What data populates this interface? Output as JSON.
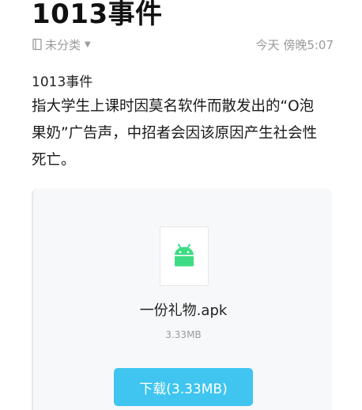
{
  "note": {
    "title": "1013事件",
    "category": "未分类",
    "timestamp": "今天 傍晚5:07",
    "subtitle": "1013事件",
    "body_lines": [
      "指大学生上课时因莫名软件而散发出的“O泡",
      "果奶”广告声，中招者会因该原因产生社会性",
      "死亡。"
    ]
  },
  "attachment": {
    "file_name": "一份礼物.apk",
    "file_size": "3.33MB",
    "download_label": "下载(3.33MB)",
    "icon": "android-icon"
  },
  "colors": {
    "accent": "#3fc5f0",
    "android": "#3ddc84",
    "muted_text": "#9a9a9a"
  }
}
